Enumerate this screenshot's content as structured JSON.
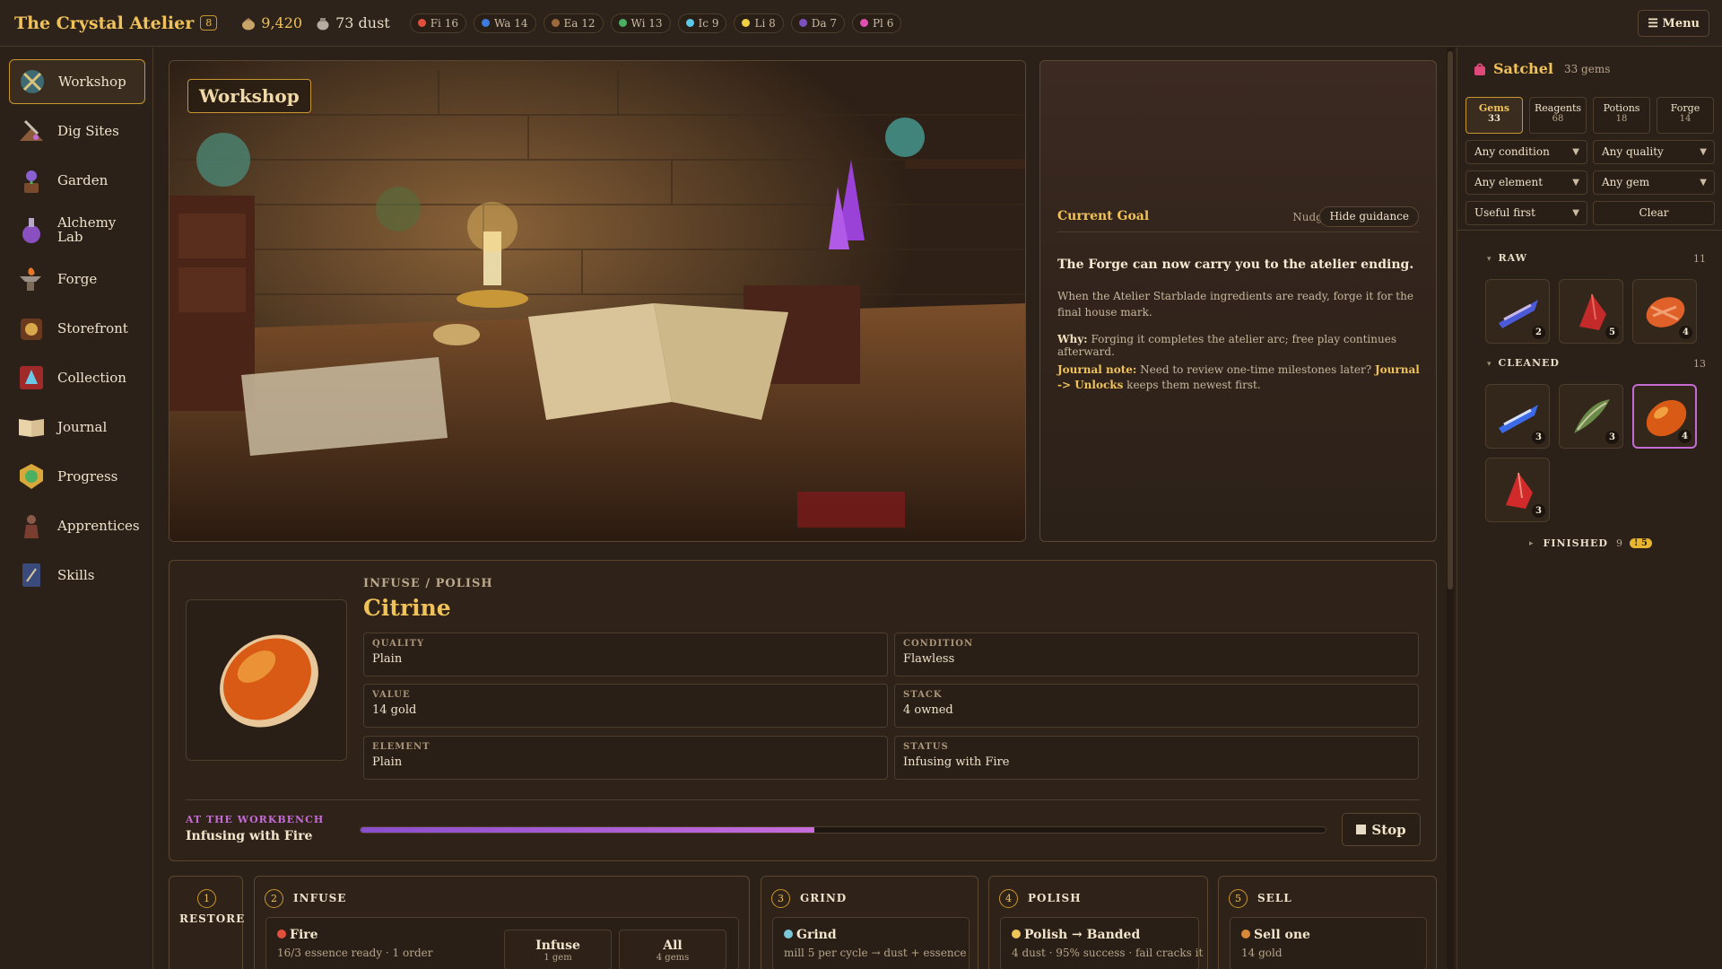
{
  "app": {
    "title": "The Crystal Atelier",
    "level": "8"
  },
  "currency": {
    "gold": "9,420",
    "dust": "73 dust"
  },
  "elements": [
    {
      "label": "Fi 16",
      "color": "#e0503c"
    },
    {
      "label": "Wa 14",
      "color": "#3c7ce0"
    },
    {
      "label": "Ea 12",
      "color": "#9c6a3a"
    },
    {
      "label": "Wi 13",
      "color": "#4cb060"
    },
    {
      "label": "Ic 9",
      "color": "#5cc8e8"
    },
    {
      "label": "Li 8",
      "color": "#f0d040"
    },
    {
      "label": "Da 7",
      "color": "#7c50c0"
    },
    {
      "label": "Pl 6",
      "color": "#e050b0"
    }
  ],
  "menu": {
    "label": "☰ Menu"
  },
  "nav": [
    {
      "label": "Workshop",
      "icon": "workshop-icon",
      "active": true
    },
    {
      "label": "Dig Sites",
      "icon": "dig-sites-icon"
    },
    {
      "label": "Garden",
      "icon": "garden-icon"
    },
    {
      "label": "Alchemy Lab",
      "icon": "alchemy-lab-icon"
    },
    {
      "label": "Forge",
      "icon": "forge-icon"
    },
    {
      "label": "Storefront",
      "icon": "storefront-icon"
    },
    {
      "label": "Collection",
      "icon": "collection-icon"
    },
    {
      "label": "Journal",
      "icon": "journal-icon"
    },
    {
      "label": "Progress",
      "icon": "progress-icon"
    },
    {
      "label": "Apprentices",
      "icon": "apprentices-icon"
    },
    {
      "label": "Skills",
      "icon": "skills-icon"
    }
  ],
  "scene": {
    "title": "Workshop"
  },
  "goal": {
    "title": "Current Goal",
    "nudge": "Nudge",
    "hide": "Hide guidance",
    "headline": "The Forge can now carry you to the atelier ending.",
    "body": "When the Atelier Starblade ingredients are ready, forge it for the final house mark.",
    "why_label": "Why:",
    "why": "Forging it completes the atelier arc; free play continues afterward.",
    "journal_label": "Journal note:",
    "journal_text": "Need to review one-time milestones later?",
    "journal_link": "Journal -> Unlocks",
    "journal_tail": "keeps them newest first."
  },
  "detail": {
    "crumb": "INFUSE / POLISH",
    "name": "Citrine",
    "fields": [
      {
        "label": "QUALITY",
        "value": "Plain"
      },
      {
        "label": "CONDITION",
        "value": "Flawless"
      },
      {
        "label": "VALUE",
        "value": "14 gold"
      },
      {
        "label": "STACK",
        "value": "4 owned"
      },
      {
        "label": "ELEMENT",
        "value": "Plain"
      },
      {
        "label": "STATUS",
        "value": "Infusing with Fire"
      }
    ],
    "workbench_label": "AT THE WORKBENCH",
    "workbench_task": "Infusing with Fire",
    "progress": 0.47,
    "stop": "Stop"
  },
  "steps": {
    "restore": {
      "num": "1",
      "title": "RESTORE"
    },
    "infuse": {
      "num": "2",
      "title": "INFUSE",
      "card_title": "Fire",
      "card_sub": "16/3 essence ready · 1 order",
      "btn1": "Infuse",
      "btn1_sub": "1 gem",
      "btn2": "All",
      "btn2_sub": "4 gems"
    },
    "grind": {
      "num": "3",
      "title": "GRIND",
      "card_title": "Grind",
      "card_sub": "mill 5 per cycle → dust + essence"
    },
    "polish": {
      "num": "4",
      "title": "POLISH",
      "card_title": "Polish → Banded",
      "card_sub": "4 dust · 95% success · fail cracks it"
    },
    "sell": {
      "num": "5",
      "title": "SELL",
      "card_title": "Sell one",
      "card_sub": "14 gold"
    }
  },
  "satchel": {
    "title": "Satchel",
    "count": "33 gems",
    "tabs": [
      {
        "label": "Gems",
        "count": "33",
        "active": true
      },
      {
        "label": "Reagents",
        "count": "68"
      },
      {
        "label": "Potions",
        "count": "18"
      },
      {
        "label": "Forge",
        "count": "14"
      }
    ],
    "filters": {
      "condition": "Any condition",
      "quality": "Any quality",
      "element": "Any element",
      "gem": "Any gem",
      "sort": "Useful first",
      "clear": "Clear"
    },
    "raw": {
      "label": "RAW",
      "count": "11",
      "counts": [
        "2",
        "5",
        "4"
      ]
    },
    "cleaned": {
      "label": "CLEANED",
      "count": "13",
      "counts": [
        "3",
        "3",
        "4",
        "3"
      ]
    },
    "finished": {
      "label": "FINISHED",
      "count": "9",
      "badge": "! 5"
    }
  }
}
